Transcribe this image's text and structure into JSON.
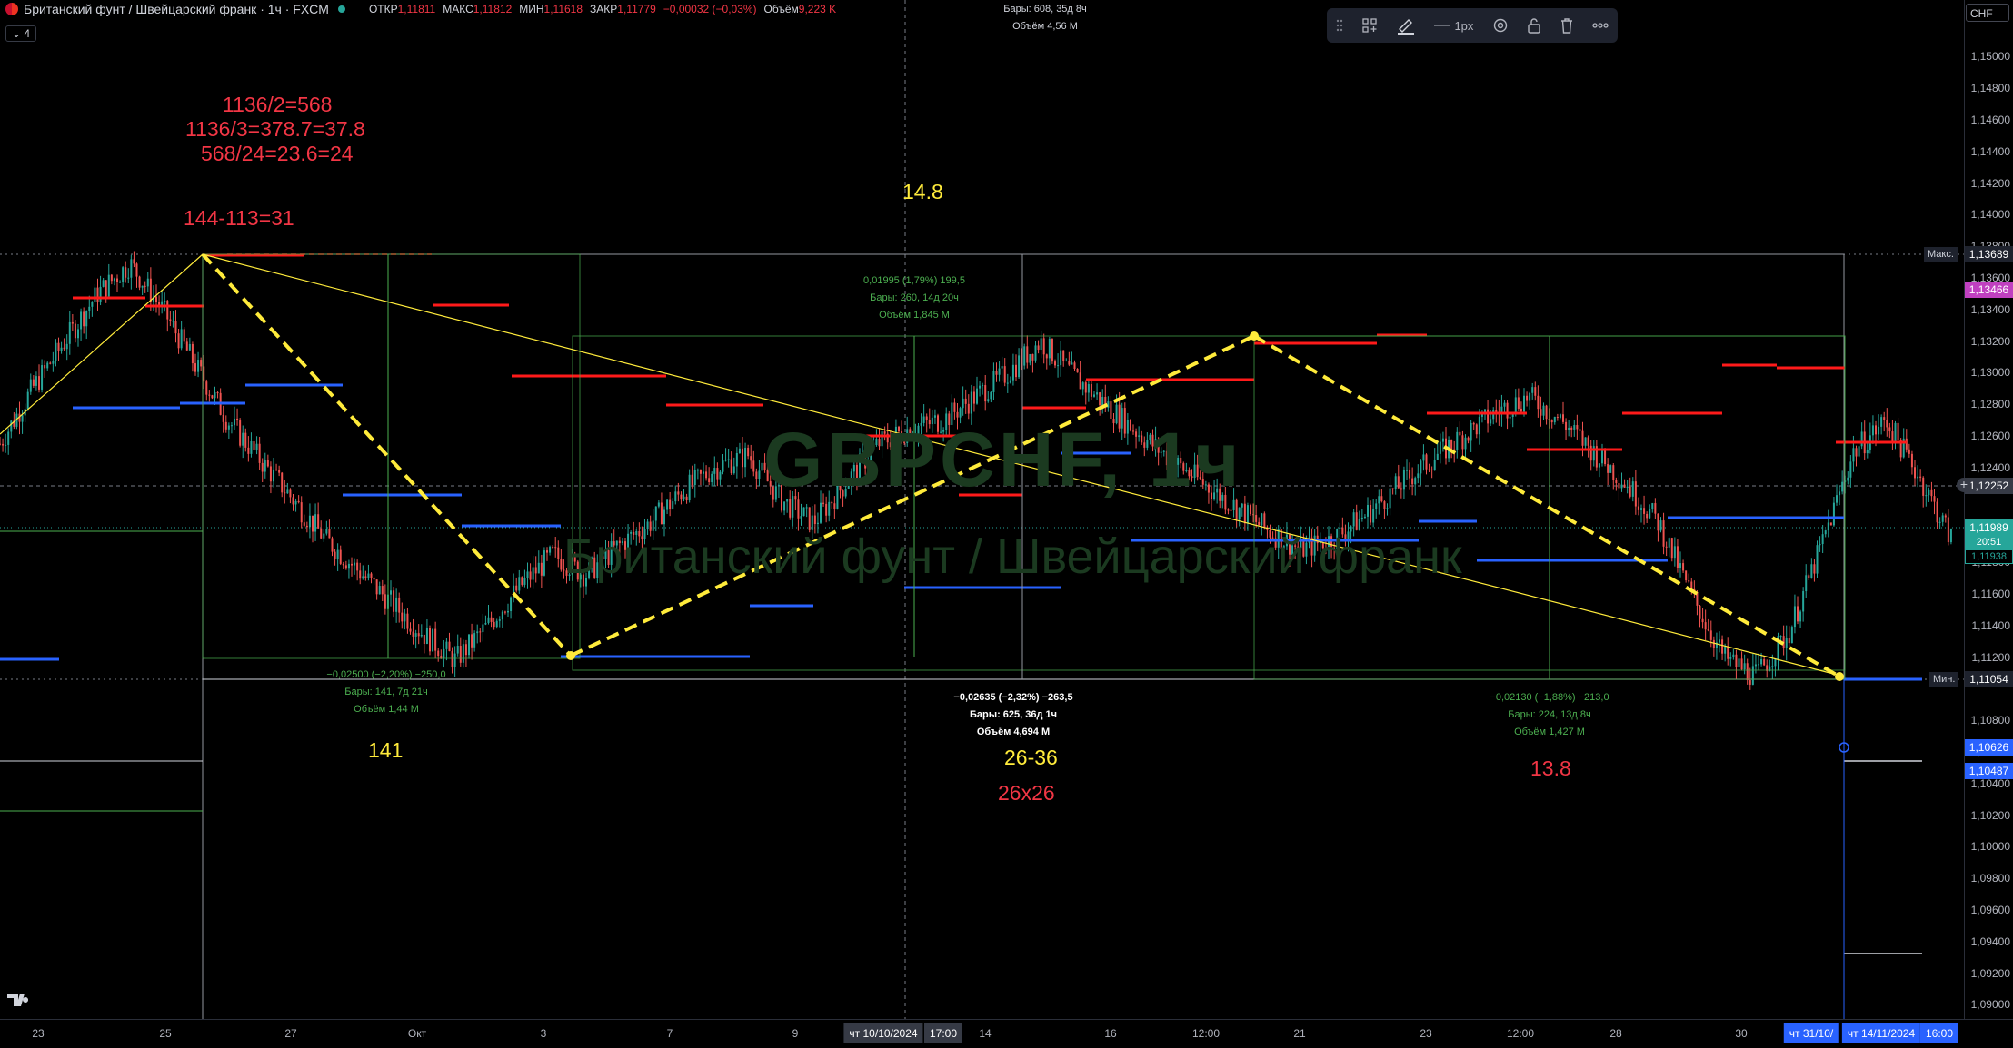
{
  "header": {
    "title": "Британский фунт / Швейцарский франк · 1ч · FXCM",
    "ohlc": [
      {
        "k": "ОТКР",
        "v": "1,11811"
      },
      {
        "k": "МАКС",
        "v": "1,11812"
      },
      {
        "k": "МИН",
        "v": "1,11618"
      },
      {
        "k": "ЗАКР",
        "v": "1,11779"
      },
      {
        "k": "",
        "v": "−0,00032 (−0,03%)"
      },
      {
        "k": "Объём",
        "v": "9,223 K"
      }
    ],
    "counter": "4"
  },
  "currency": "CHF",
  "toolbar": {
    "width_label": "1px"
  },
  "top_info": {
    "line1": "Бары: 608, 35д 8ч",
    "line2": "Объём 4,56 M"
  },
  "watermark": {
    "symbol": "GBPCHF, 1ч",
    "name": "Британский фунт / Швейцарский франк"
  },
  "annotations": {
    "calc1": "1136/2=568",
    "calc2": "1136/3=378.7=37.8",
    "calc3": "568/24=23.6=24",
    "calc4": "144-113=31",
    "n148": "14.8",
    "n141": "141",
    "n2636": "26-36",
    "n2626": "26x26",
    "n138": "13.8"
  },
  "measures": [
    {
      "l1": "0,01995 (1,79%) 199,5",
      "l2": "Бары: 260, 14д 20ч",
      "l3": "Объём 1,845 M"
    },
    {
      "l1": "−0,02500 (−2,20%) −250,0",
      "l2": "Бары: 141, 7д 21ч",
      "l3": "Объём 1,44 M"
    },
    {
      "l1": "−0,02635 (−2,32%) −263,5",
      "l2": "Бары: 625, 36д 1ч",
      "l3": "Объём 4,694 M"
    },
    {
      "l1": "−0,02130 (−1,88%) −213,0",
      "l2": "Бары: 224, 13д 8ч",
      "l3": "Объём 1,427 M"
    }
  ],
  "price_axis": {
    "labels": [
      "1,15000",
      "1,14800",
      "1,14600",
      "1,14400",
      "1,14200",
      "1,14000",
      "1,13800",
      "1,13600",
      "1,13400",
      "1,13200",
      "1,13000",
      "1,12800",
      "1,12600",
      "1,12400",
      "1,12000",
      "1,11800",
      "1,11600",
      "1,11400",
      "1,11200",
      "1,10800",
      "1,10600",
      "1,10400",
      "1,10200",
      "1,10000",
      "1,09800",
      "1,09600",
      "1,09400",
      "1,09200",
      "1,09000"
    ],
    "max_tag": {
      "label": "Макс.",
      "value": "1,13689"
    },
    "pink_tag": "1,13466",
    "cursor_tag": "1,12252",
    "current": {
      "value": "1,11989",
      "countdown": "20:51"
    },
    "current_low": "1,11938",
    "min_tag": {
      "label": "Мин.",
      "value": "1,11054"
    },
    "blue1": "1,10626",
    "blue2": "1,10487"
  },
  "time_axis": {
    "labels": [
      "23",
      "25",
      "27",
      "Окт",
      "3",
      "7",
      "9",
      "14",
      "16",
      "12:00",
      "21",
      "23",
      "12:00",
      "28",
      "30"
    ],
    "cursor_date": "чт 10/10/2024",
    "cursor_time": "17:00",
    "range_start": "чт 31/10/",
    "range_end": "чт 14/11/2024",
    "range_time": "16:00"
  },
  "colors": {
    "red_level": "#ff1a1a",
    "blue_level": "#2962ff",
    "zigzag": "#ffeb3b",
    "green_measure": "#4caf50",
    "annotation_red": "#f23645",
    "annotation_yellow": "#ffeb3b",
    "candle_up": "#26a69a",
    "candle_down": "#ef5350"
  },
  "price_range": {
    "top": 1.151,
    "bottom": 1.0895
  },
  "chart_data": {
    "type": "candlestick",
    "instrument": "GBPCHF",
    "timeframe": "1h",
    "path_prices": [
      1.1255,
      1.129,
      1.132,
      1.135,
      1.1369,
      1.134,
      1.1305,
      1.127,
      1.1245,
      1.122,
      1.1195,
      1.1175,
      1.1155,
      1.1135,
      1.1118,
      1.114,
      1.1165,
      1.1185,
      1.1172,
      1.119,
      1.1205,
      1.1225,
      1.124,
      1.1248,
      1.122,
      1.1205,
      1.123,
      1.1255,
      1.1265,
      1.127,
      1.1285,
      1.13,
      1.132,
      1.1298,
      1.128,
      1.1262,
      1.1245,
      1.123,
      1.1215,
      1.12,
      1.1188,
      1.1195,
      1.121,
      1.1228,
      1.1245,
      1.126,
      1.1275,
      1.1285,
      1.127,
      1.125,
      1.123,
      1.1205,
      1.116,
      1.112,
      1.1108,
      1.1135,
      1.119,
      1.125,
      1.127,
      1.1235,
      1.1195
    ],
    "zigzag": [
      [
        1.1369
      ],
      [
        1.1118
      ],
      [
        1.132
      ],
      [
        1.1108
      ]
    ]
  }
}
